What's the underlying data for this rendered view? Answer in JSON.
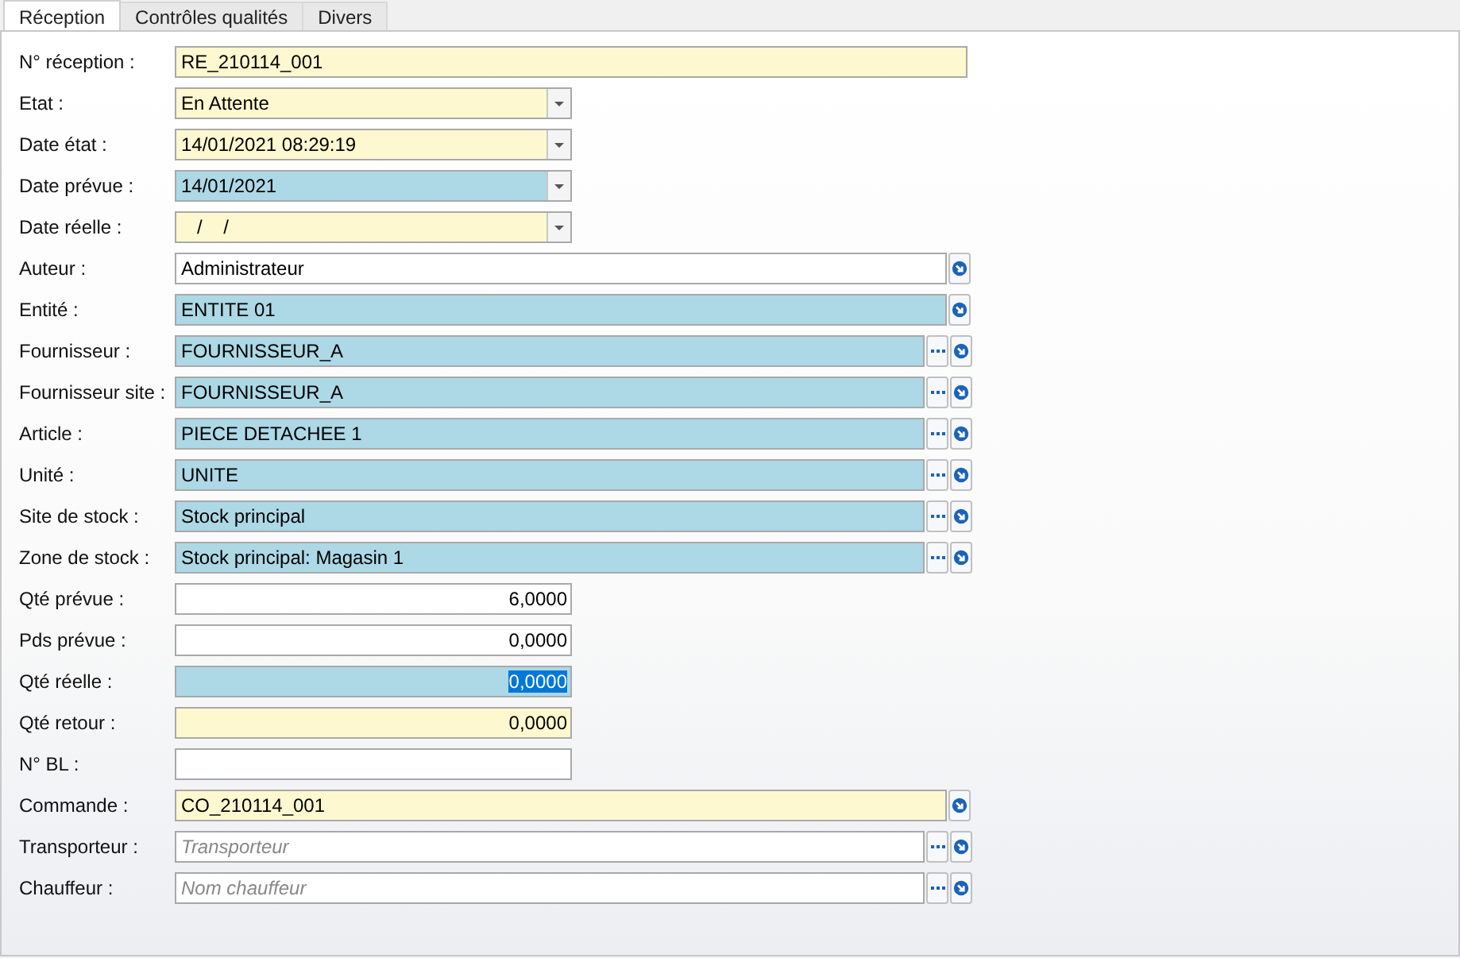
{
  "tabs": [
    {
      "label": "Réception",
      "selected": true
    },
    {
      "label": "Contrôles qualités",
      "selected": false
    },
    {
      "label": "Divers",
      "selected": false
    }
  ],
  "fields": [
    {
      "label": "N° réception :",
      "kind": "text",
      "color": "#fdf8cf",
      "value": "RE_210114_001"
    },
    {
      "label": "Etat :",
      "kind": "combo",
      "color": "#fdf8cf",
      "value": "En Attente"
    },
    {
      "label": "Date état :",
      "kind": "combo",
      "color": "#fdf8cf",
      "value": "14/01/2021 08:29:19"
    },
    {
      "label": "Date  prévue :",
      "kind": "combo",
      "color": "#add8e6",
      "value": "14/01/2021"
    },
    {
      "label": "Date réelle :",
      "kind": "combo",
      "color": "#fdf8cf",
      "value": "   /    /"
    },
    {
      "label": "Auteur :",
      "kind": "lookup",
      "color": "#ffffff",
      "value": "Administrateur",
      "browse": false
    },
    {
      "label": "Entité :",
      "kind": "lookup",
      "color": "#add8e6",
      "value": "ENTITE 01",
      "browse": false
    },
    {
      "label": "Fournisseur :",
      "kind": "lookup",
      "color": "#add8e6",
      "value": "FOURNISSEUR_A",
      "browse": true
    },
    {
      "label": "Fournisseur site :",
      "kind": "lookup",
      "color": "#add8e6",
      "value": "FOURNISSEUR_A",
      "browse": true
    },
    {
      "label": "Article :",
      "kind": "lookup",
      "color": "#add8e6",
      "value": "PIECE DETACHEE 1",
      "browse": true
    },
    {
      "label": "Unité :",
      "kind": "lookup",
      "color": "#add8e6",
      "value": "UNITE",
      "browse": true
    },
    {
      "label": "Site de stock :",
      "kind": "lookup",
      "color": "#add8e6",
      "value": "Stock principal",
      "browse": true
    },
    {
      "label": "Zone de stock :",
      "kind": "lookup",
      "color": "#add8e6",
      "value": "Stock principal: Magasin 1",
      "browse": true
    },
    {
      "label": "Qté prévue :",
      "kind": "number",
      "color": "#ffffff",
      "value": "6,0000",
      "selected": false
    },
    {
      "label": "Pds prévue :",
      "kind": "number",
      "color": "#ffffff",
      "value": "0,0000",
      "selected": false
    },
    {
      "label": "Qté réelle :",
      "kind": "number",
      "color": "#add8e6",
      "value": "0,0000",
      "selected": true
    },
    {
      "label": "Qté retour :",
      "kind": "number",
      "color": "#fdf8cf",
      "value": "0,0000",
      "selected": false
    },
    {
      "label": "N° BL :",
      "kind": "short",
      "color": "#ffffff"
    },
    {
      "label": "Commande :",
      "kind": "lookup",
      "color": "#fdf8cf",
      "value": "CO_210114_001",
      "browse": false
    },
    {
      "label": "Transporteur :",
      "kind": "lookup",
      "color": "#ffffff",
      "placeholder": "Transporteur",
      "browse": true
    },
    {
      "label": "Chauffeur :",
      "kind": "lookup",
      "color": "#ffffff",
      "placeholder": "Nom chauffeur",
      "browse": true
    }
  ]
}
